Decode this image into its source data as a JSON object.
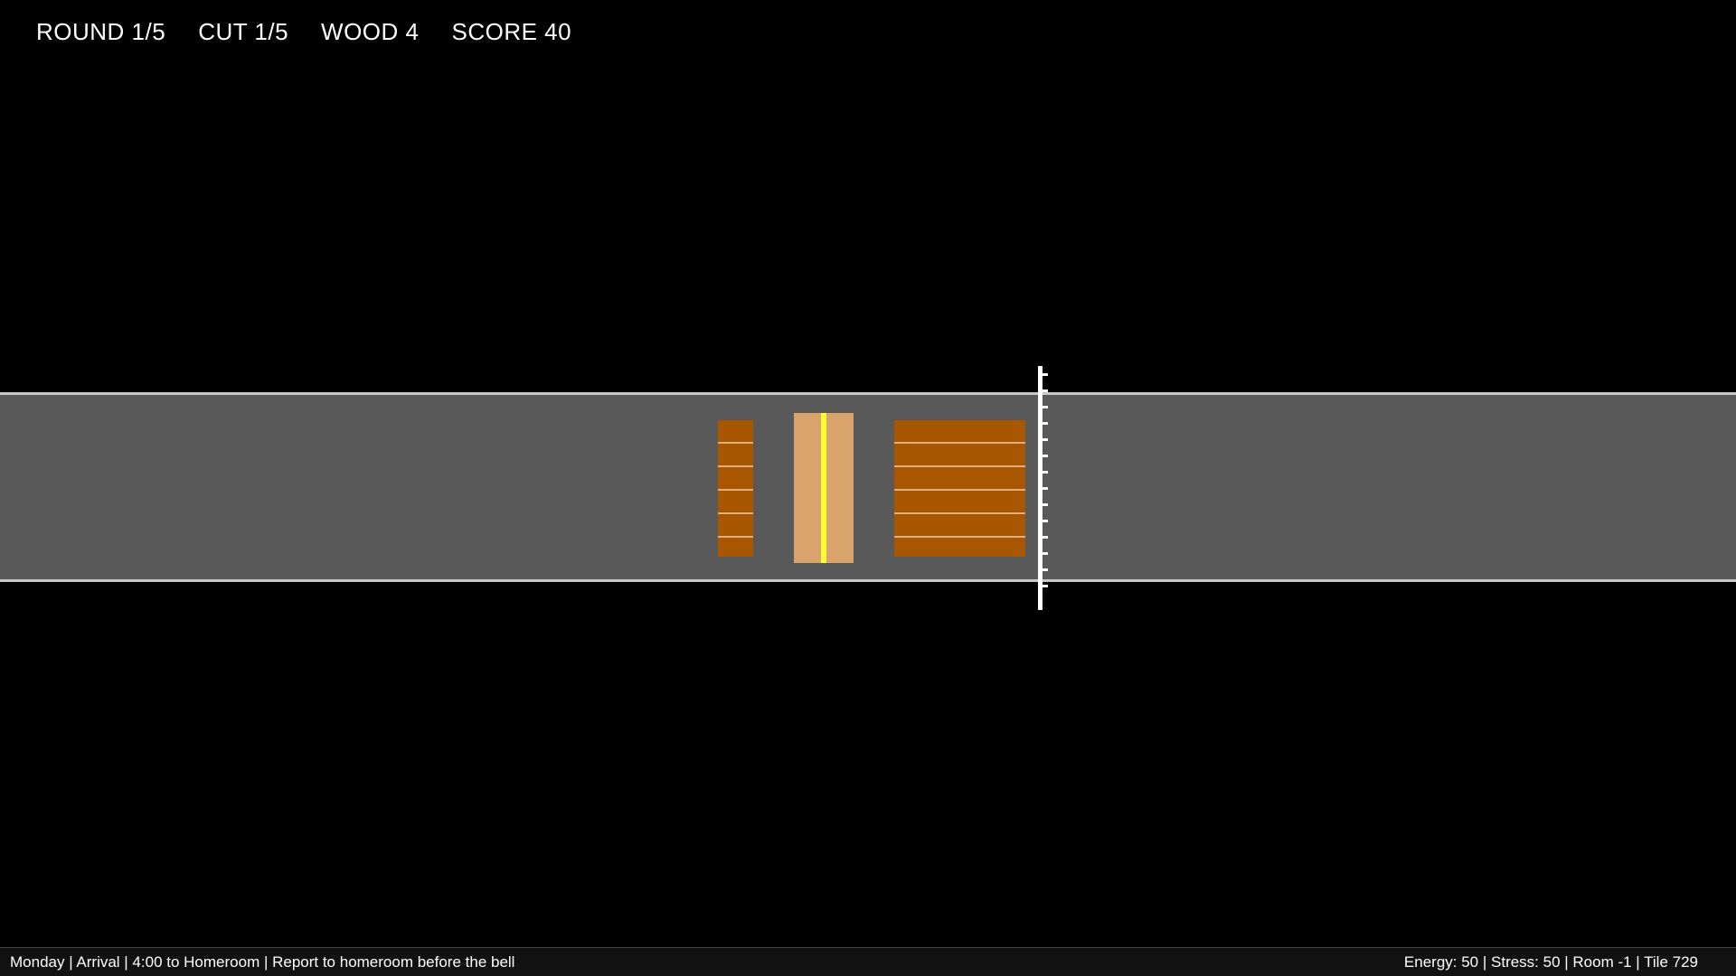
{
  "hud": {
    "round": "ROUND 1/5",
    "cut": "CUT 1/5",
    "wood": "WOOD 4",
    "score": "SCORE 40"
  },
  "status_bar": {
    "left": "Monday | Arrival | 4:00 to Homeroom | Report to homeroom before the bell",
    "right": "Energy: 50 | Stress: 50 | Room -1 | Tile 729"
  },
  "colors": {
    "background": "#000000",
    "conveyor_belt": "#595959",
    "belt_edge": "#c8c8c8",
    "plank_cut": "#a85600",
    "plank_active": "#d9a46c",
    "cut_guide": "#ffff33",
    "saw_blade": "#ffffff"
  },
  "icons": {
    "saw": "saw-blade-icon"
  }
}
